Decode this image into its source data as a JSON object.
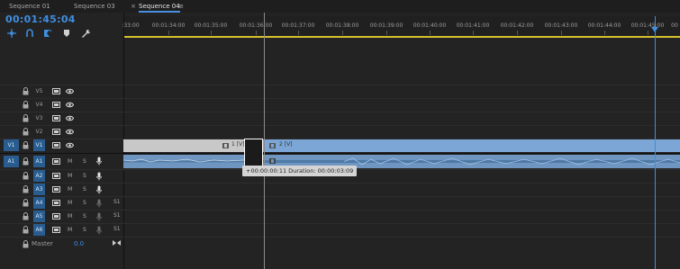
{
  "tabs": [
    {
      "label": "Sequence 01"
    },
    {
      "label": "Sequence 03"
    },
    {
      "label": "Sequence 04"
    }
  ],
  "tab_close_symbol": "×",
  "tab_menu_symbol": "≡",
  "timecode": "00:01:45:04",
  "toolbar_icons": [
    "snap-icon",
    "linked-selection-icon",
    "add-marker-icon",
    "marker-icon",
    "wrench-icon"
  ],
  "ruler_labels": [
    {
      "label": ":33:00"
    },
    {
      "label": "00:01:34:00"
    },
    {
      "label": "00:01:35:00"
    },
    {
      "label": "00:01:36:00"
    },
    {
      "label": "00:01:37:00"
    },
    {
      "label": "00:01:38:00"
    },
    {
      "label": "00:01:39:00"
    },
    {
      "label": "00:01:40:00"
    },
    {
      "label": "00:01:41:00"
    },
    {
      "label": "00:01:42:00"
    },
    {
      "label": "00:01:43:00"
    },
    {
      "label": "00:01:44:00"
    },
    {
      "label": "00:01:45:00"
    },
    {
      "label": "00"
    }
  ],
  "video_tracks": [
    {
      "name": "V5"
    },
    {
      "name": "V4"
    },
    {
      "name": "V3"
    },
    {
      "name": "V2"
    },
    {
      "name": "V1",
      "source": "V1"
    }
  ],
  "audio_tracks": [
    {
      "name": "A1",
      "source": "A1",
      "m": "M",
      "s": "S"
    },
    {
      "name": "A2",
      "m": "M",
      "s": "S"
    },
    {
      "name": "A3",
      "m": "M",
      "s": "S"
    },
    {
      "name": "A4",
      "m": "M",
      "s": "S",
      "extra": "S1"
    },
    {
      "name": "A5",
      "m": "M",
      "s": "S",
      "extra": "S1"
    },
    {
      "name": "A6",
      "m": "M",
      "s": "S",
      "extra": "S1"
    }
  ],
  "master": {
    "label": "Master",
    "value": "0.0"
  },
  "clips": {
    "v1_first_label": "1 [V]",
    "v1_second_label": "2 [V]"
  },
  "tooltip": "+00:00:00:11 Duration: 00:00:03:09",
  "colors": {
    "accent": "#3f8ee0",
    "track_selected": "#2a5d8f",
    "video_clip": "#7ba6d6",
    "audio_clip": "#6f96c0",
    "work_area": "#d7c12e"
  }
}
